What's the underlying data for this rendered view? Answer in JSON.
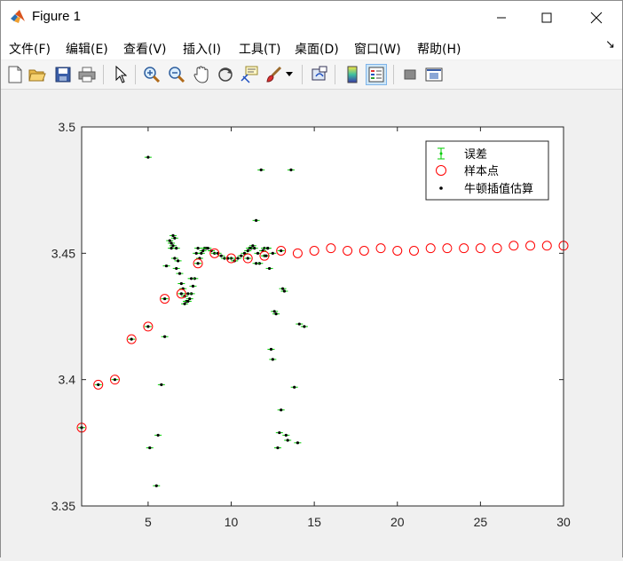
{
  "window": {
    "title": "Figure 1",
    "controls": {
      "minimize": "minimize",
      "maximize": "maximize",
      "close": "close"
    }
  },
  "menu": {
    "items": [
      "文件(F)",
      "编辑(E)",
      "查看(V)",
      "插入(I)",
      "工具(T)",
      "桌面(D)",
      "窗口(W)",
      "帮助(H)"
    ]
  },
  "toolbar": {
    "buttons": [
      {
        "icon": "new-figure-icon"
      },
      {
        "icon": "open-file-icon"
      },
      {
        "icon": "save-icon"
      },
      {
        "icon": "print-icon"
      },
      {
        "icon": "pointer-icon"
      },
      {
        "icon": "zoom-in-icon"
      },
      {
        "icon": "zoom-out-icon"
      },
      {
        "icon": "pan-hand-icon"
      },
      {
        "icon": "rotate-3d-icon"
      },
      {
        "icon": "data-cursor-icon"
      },
      {
        "icon": "brush-icon"
      },
      {
        "icon": "link-plot-icon"
      },
      {
        "icon": "colorbar-icon"
      },
      {
        "icon": "legend-icon"
      },
      {
        "icon": "hide-plot-tools-icon"
      },
      {
        "icon": "show-plot-tools-icon"
      }
    ]
  },
  "chart_data": {
    "type": "scatter",
    "xlim": [
      1,
      30
    ],
    "ylim": [
      3.35,
      3.5
    ],
    "xticks": [
      5,
      10,
      15,
      20,
      25,
      30
    ],
    "yticks": [
      3.35,
      3.4,
      3.45,
      3.5
    ],
    "ytick_labels": [
      "3.35",
      "3.4",
      "3.45",
      "3.5"
    ],
    "legend": {
      "position": "top-right",
      "entries": [
        "误差",
        "样本点",
        "牛顿插值估算"
      ]
    },
    "colors": {
      "errorbar": "#00cc00",
      "sample": "#ff0000",
      "estimate": "#000000"
    },
    "series": [
      {
        "name": "样本点",
        "marker": "circle",
        "x": [
          1,
          2,
          3,
          4,
          5,
          6,
          7,
          8,
          9,
          10,
          11,
          12,
          13,
          14,
          15,
          16,
          17,
          18,
          19,
          20,
          21,
          22,
          23,
          24,
          25,
          26,
          27,
          28,
          29,
          30
        ],
        "y": [
          3.381,
          3.398,
          3.4,
          3.416,
          3.421,
          3.432,
          3.434,
          3.446,
          3.45,
          3.448,
          3.448,
          3.449,
          3.451,
          3.45,
          3.451,
          3.452,
          3.451,
          3.451,
          3.452,
          3.451,
          3.451,
          3.452,
          3.452,
          3.452,
          3.452,
          3.452,
          3.453,
          3.453,
          3.453,
          3.453
        ]
      },
      {
        "name": "牛顿插值估算",
        "marker": "dot",
        "x": [
          1,
          2,
          3,
          4,
          5,
          6,
          7,
          8,
          9,
          10,
          11,
          12,
          13,
          5.0,
          5.1,
          5.5,
          5.6,
          5.8,
          6.0,
          6.1,
          6.3,
          6.4,
          6.5,
          6.6,
          6.7,
          6.8,
          6.9,
          7.0,
          7.1,
          7.2,
          7.3,
          7.4,
          7.5,
          7.6,
          7.7,
          7.8,
          8.1,
          8.2,
          8.3,
          8.4,
          8.5,
          8.6,
          8.8,
          9.2,
          9.4,
          9.6,
          9.8,
          10.2,
          10.4,
          10.6,
          10.8,
          11.0,
          11.1,
          11.2,
          11.3,
          11.4,
          11.5,
          11.6,
          11.7,
          11.8,
          11.9,
          12.0,
          12.1,
          12.2,
          12.3,
          12.4,
          12.5,
          12.6,
          12.7,
          12.8,
          12.9,
          13.0,
          13.1,
          13.2,
          13.3,
          13.4,
          13.6,
          13.8,
          14.0,
          14.1,
          14.4,
          6.4,
          6.5,
          6.6,
          6.7,
          7.2,
          7.4,
          7.6,
          7.9,
          8.0,
          11.5,
          12.2,
          12.5
        ],
        "y": [
          3.381,
          3.398,
          3.4,
          3.416,
          3.421,
          3.432,
          3.434,
          3.446,
          3.45,
          3.448,
          3.448,
          3.449,
          3.451,
          3.488,
          3.373,
          3.358,
          3.378,
          3.398,
          3.417,
          3.445,
          3.455,
          3.452,
          3.457,
          3.456,
          3.452,
          3.447,
          3.442,
          3.438,
          3.436,
          3.433,
          3.431,
          3.431,
          3.432,
          3.434,
          3.437,
          3.44,
          3.448,
          3.45,
          3.451,
          3.452,
          3.452,
          3.452,
          3.451,
          3.45,
          3.449,
          3.448,
          3.448,
          3.447,
          3.448,
          3.449,
          3.45,
          3.451,
          3.452,
          3.452,
          3.453,
          3.452,
          3.463,
          3.45,
          3.446,
          3.483,
          3.451,
          3.452,
          3.449,
          3.452,
          3.444,
          3.412,
          3.408,
          3.427,
          3.426,
          3.373,
          3.379,
          3.388,
          3.436,
          3.435,
          3.378,
          3.376,
          3.483,
          3.397,
          3.375,
          3.422,
          3.421,
          3.454,
          3.453,
          3.448,
          3.444,
          3.43,
          3.434,
          3.44,
          3.45,
          3.452,
          3.446,
          3.452,
          3.45
        ]
      }
    ]
  }
}
